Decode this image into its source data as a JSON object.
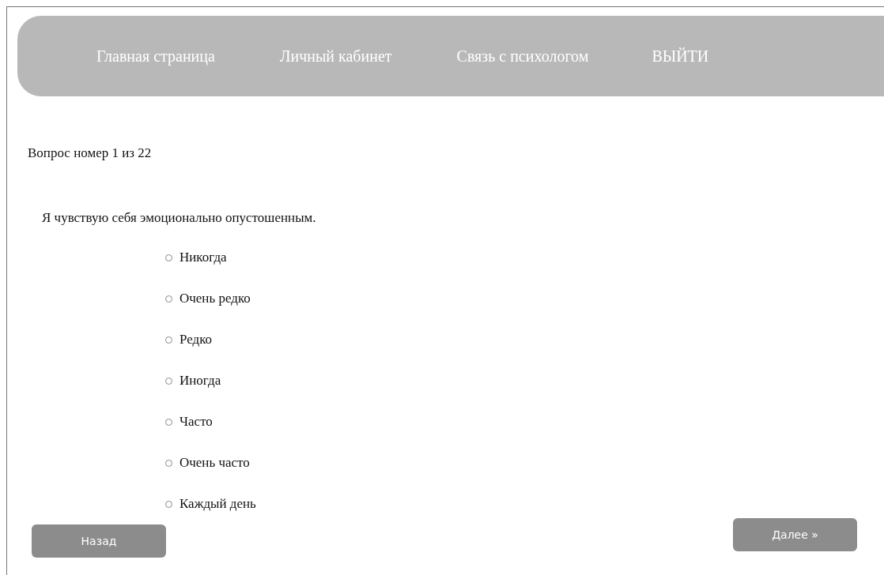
{
  "nav": {
    "items": [
      {
        "label": "Главная страница"
      },
      {
        "label": "Личный кабинет"
      },
      {
        "label": "Связь с психологом"
      },
      {
        "label": "ВЫЙТИ"
      }
    ]
  },
  "progress": "Вопрос номер 1 из 22",
  "question": "Я чувствую себя эмоционально опустошенным.",
  "options": [
    {
      "label": "Никогда",
      "selected": false
    },
    {
      "label": "Очень редко",
      "selected": false
    },
    {
      "label": "Редко",
      "selected": false
    },
    {
      "label": "Иногда",
      "selected": false
    },
    {
      "label": "Часто",
      "selected": false
    },
    {
      "label": "Очень часто",
      "selected": false
    },
    {
      "label": "Каждый день",
      "selected": false
    }
  ],
  "buttons": {
    "back": "Назад",
    "next": "Далее »"
  }
}
